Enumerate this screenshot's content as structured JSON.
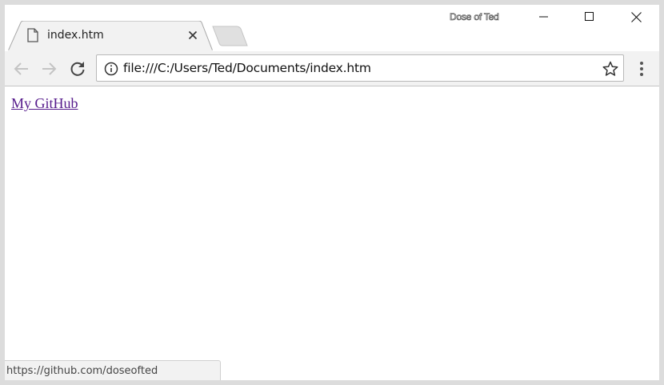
{
  "window": {
    "profile_name": "Dose of Ted",
    "controls": {
      "minimize": "minimize",
      "maximize": "maximize",
      "close": "close"
    }
  },
  "tabs": [
    {
      "title": "index.htm",
      "icon": "file-icon",
      "active": true
    }
  ],
  "toolbar": {
    "back_icon": "arrow-left-icon",
    "forward_icon": "arrow-right-icon",
    "reload_icon": "reload-icon",
    "url": "file:///C:/Users/Ted/Documents/index.htm",
    "info_icon": "info-icon",
    "bookmark_icon": "star-icon",
    "menu_icon": "vertical-dots-icon"
  },
  "page": {
    "link_text": "My GitHub",
    "link_color": "#551a8b"
  },
  "status_bar": {
    "text": "https://github.com/doseofted"
  }
}
